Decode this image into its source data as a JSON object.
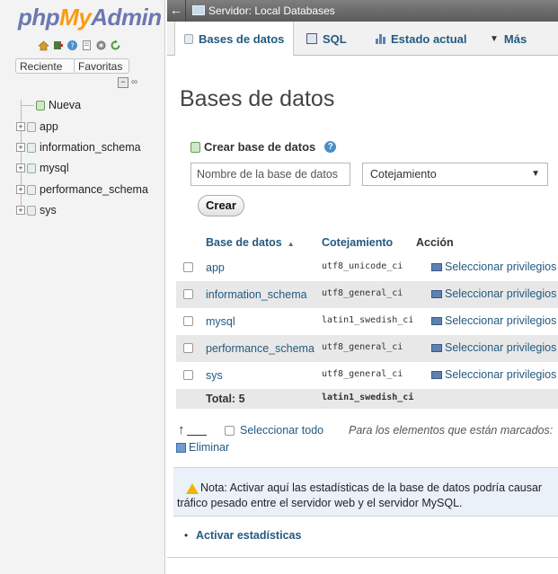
{
  "nav": {
    "logo": {
      "php": "php",
      "my": "My",
      "admin": "Admin"
    },
    "icons": [
      "home-icon",
      "exit-icon",
      "help-icon",
      "docs-icon",
      "settings-icon",
      "reload-icon"
    ],
    "recent_label": "Reciente",
    "favorites_label": "Favoritas",
    "new_label": "Nueva",
    "databases": [
      "app",
      "information_schema",
      "mysql",
      "performance_schema",
      "sys"
    ]
  },
  "topbar": {
    "server_label": "Servidor: Local Databases"
  },
  "tabs": [
    {
      "label": "Bases de datos",
      "icon": "database-icon",
      "active": true
    },
    {
      "label": "SQL",
      "icon": "sql-icon",
      "active": false
    },
    {
      "label": "Estado actual",
      "icon": "status-icon",
      "active": false
    },
    {
      "label": "Más",
      "icon": "chevron-down-icon",
      "active": false
    }
  ],
  "main": {
    "title": "Bases de datos",
    "create_section_label": "Crear base de datos",
    "dbname_placeholder": "Nombre de la base de datos",
    "collation_label": "Cotejamiento",
    "create_button": "Crear",
    "table": {
      "headers": {
        "name": "Base de datos",
        "collation": "Cotejamiento",
        "action": "Acción"
      },
      "rows": [
        {
          "name": "app",
          "collation": "utf8_unicode_ci",
          "action": "Seleccionar privilegios"
        },
        {
          "name": "information_schema",
          "collation": "utf8_general_ci",
          "action": "Seleccionar privilegios"
        },
        {
          "name": "mysql",
          "collation": "latin1_swedish_ci",
          "action": "Seleccionar privilegios"
        },
        {
          "name": "performance_schema",
          "collation": "utf8_general_ci",
          "action": "Seleccionar privilegios"
        },
        {
          "name": "sys",
          "collation": "utf8_general_ci",
          "action": "Seleccionar privilegios"
        }
      ],
      "footer": {
        "total": "Total: 5",
        "collation": "latin1_swedish_ci"
      }
    },
    "select_all_label": "Seleccionar todo",
    "marked_text": "Para los elementos que están marcados:",
    "delete_label": "Eliminar",
    "notice_text": "Nota: Activar aquí las estadísticas de la base de datos podría causar tráfico pesado entre el servidor web y el servidor MySQL.",
    "activate_stats_label": "Activar estadísticas"
  },
  "colors": {
    "link": "#235a81",
    "logo_blue": "#6c78af",
    "logo_orange": "#f89c0e",
    "topbar": "#6b6b6b",
    "row_alt": "#e8e8e8",
    "notice_bg": "#eaf1f9"
  }
}
